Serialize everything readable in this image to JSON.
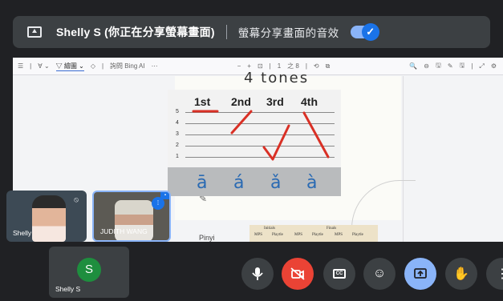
{
  "banner": {
    "presenter_title": "Shelly S (你正在分享螢幕畫面)",
    "audio_label": "螢幕分享畫面的音效",
    "audio_toggle_on": true,
    "toggle_check": "✓"
  },
  "pdf_toolbar": {
    "items": [
      "☰",
      "|",
      "∀ ⌄",
      "▽ 繪圖 ⌄",
      "◇",
      "|",
      "詢問 Bing AI",
      "⋯",
      "−",
      "+",
      "⊡",
      "|",
      "1",
      "之 8",
      "|",
      "⟲",
      "⧉",
      "🔍",
      "⊖",
      "🖫",
      "✎",
      "🖫",
      "|",
      "⤢",
      "⚙"
    ]
  },
  "slide": {
    "heading": "4 tones",
    "tone_headers": [
      "1st",
      "2nd",
      "3rd",
      "4th"
    ],
    "scale_numbers": [
      "5",
      "4",
      "3",
      "2",
      "1"
    ],
    "pinyin": [
      "ā",
      "á",
      "ǎ",
      "à"
    ],
    "table_header": [
      "Initials",
      "Finals"
    ],
    "table_row": [
      "MPS",
      "Playtle",
      "MPS",
      "Playtle",
      "MPS",
      "Playtle"
    ],
    "bottom_left_text": "Pinyi"
  },
  "participants": [
    {
      "name": "Shelly",
      "muted": true
    },
    {
      "name": "JUDITH WANG",
      "speaking": true
    }
  ],
  "self_tile": {
    "avatar_letter": "S",
    "name": "Shelly S"
  },
  "controls": {
    "cc_label": "CC",
    "colors": {
      "accent": "#8ab4f8",
      "danger": "#ea4335",
      "tone_line": "#d93025"
    }
  }
}
